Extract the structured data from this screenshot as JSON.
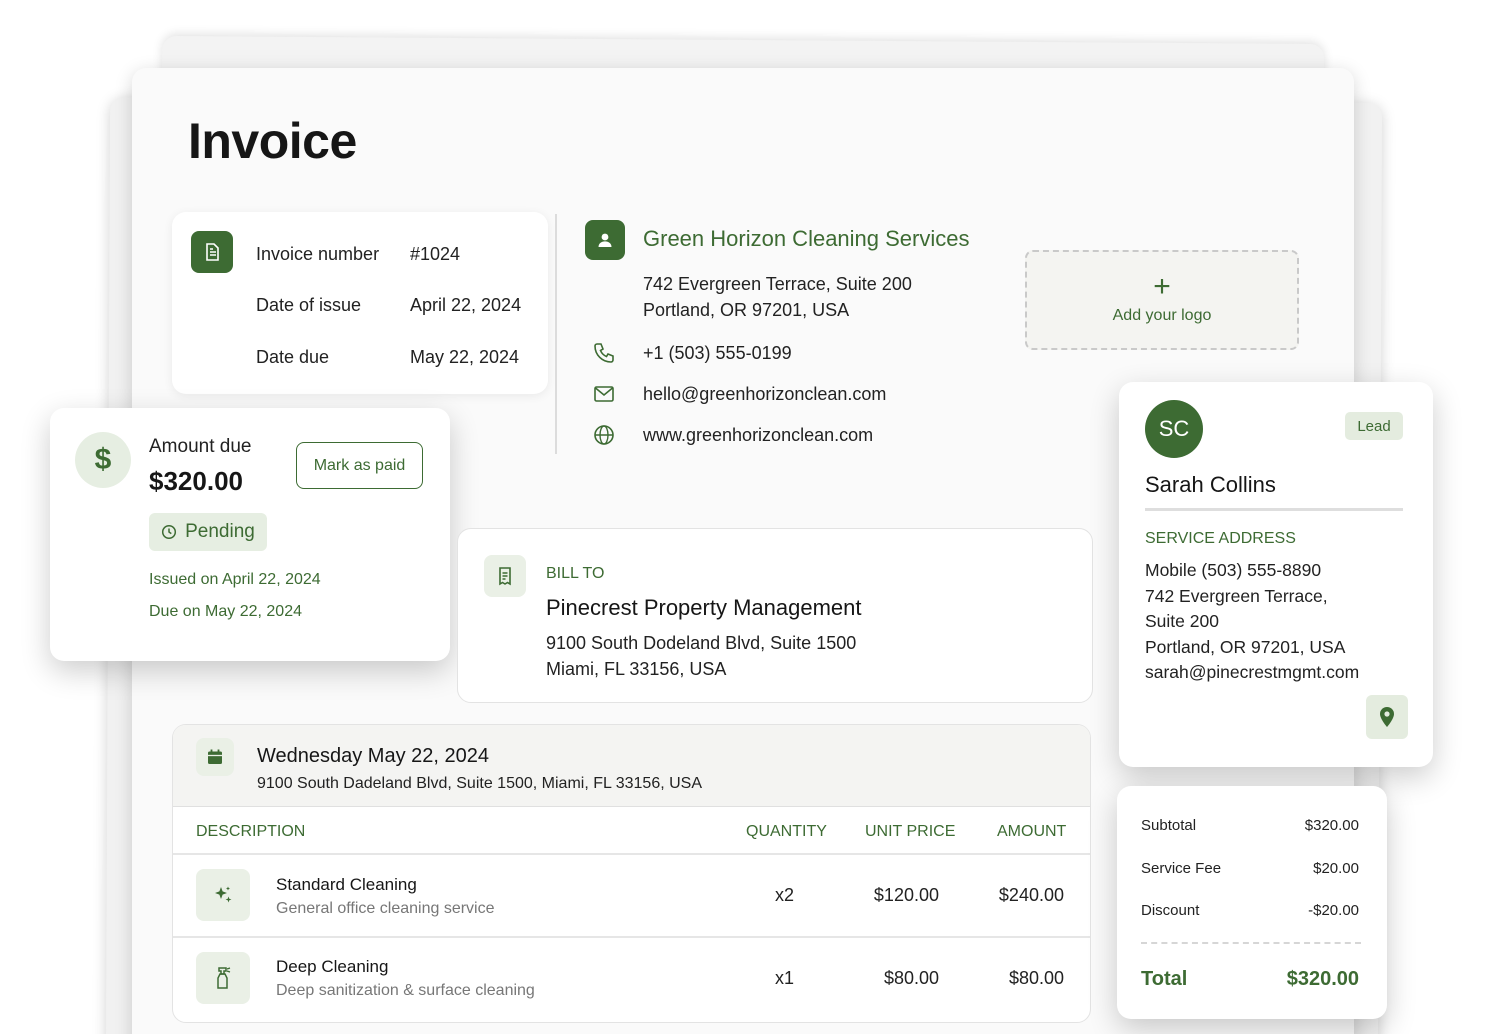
{
  "title": "Invoice",
  "invoice_meta": {
    "rows": [
      {
        "label": "Invoice number",
        "value": "#1024"
      },
      {
        "label": "Date of issue",
        "value": "April 22, 2024"
      },
      {
        "label": "Date due",
        "value": "May 22, 2024"
      }
    ]
  },
  "company": {
    "name": "Green Horizon Cleaning Services",
    "address_line1": "742 Evergreen Terrace, Suite 200",
    "address_line2": "Portland, OR 97201, USA",
    "phone": "+1 (503) 555-0199",
    "email": "hello@greenhorizonclean.com",
    "website": "www.greenhorizonclean.com"
  },
  "logo_placeholder": {
    "icon": "+",
    "label": "Add your logo"
  },
  "amount_card": {
    "label": "Amount due",
    "value": "$320.00",
    "button": "Mark as paid",
    "status": "Pending",
    "issued": "Issued on April 22, 2024",
    "due": "Due on May 22, 2024"
  },
  "bill_to": {
    "label": "BILL TO",
    "name": "Pinecrest Property Management",
    "address_line1": "9100 South Dodeland Blvd, Suite 1500",
    "address_line2": "Miami, FL 33156, USA"
  },
  "client": {
    "initials": "SC",
    "badge": "Lead",
    "name": "Sarah Collins",
    "service_label": "SERVICE ADDRESS",
    "lines": [
      "Mobile (503) 555-8890",
      "742 Evergreen Terrace,",
      "Suite 200",
      "Portland, OR 97201, USA",
      "sarah@pinecrestmgmt.com"
    ]
  },
  "schedule": {
    "date": "Wednesday May 22, 2024",
    "address": "9100 South Dadeland Blvd, Suite 1500, Miami, FL 33156, USA"
  },
  "items_table": {
    "headers": {
      "description": "DESCRIPTION",
      "quantity": "QUANTITY",
      "unit_price": "UNIT PRICE",
      "amount": "AMOUNT"
    },
    "rows": [
      {
        "name": "Standard Cleaning",
        "description": "General office cleaning service",
        "quantity": "x2",
        "unit_price": "$120.00",
        "amount": "$240.00",
        "icon": "sparkles-icon"
      },
      {
        "name": "Deep Cleaning",
        "description": "Deep sanitization & surface cleaning",
        "quantity": "x1",
        "unit_price": "$80.00",
        "amount": "$80.00",
        "icon": "spray-bottle-icon"
      }
    ]
  },
  "totals": {
    "subtotal_label": "Subtotal",
    "subtotal": "$320.00",
    "fee_label": "Service Fee",
    "fee": "$20.00",
    "discount_label": "Discount",
    "discount": "-$20.00",
    "total_label": "Total",
    "total": "$320.00"
  },
  "colors": {
    "accent": "#3d6b33",
    "accent_light": "#e6eee2"
  }
}
